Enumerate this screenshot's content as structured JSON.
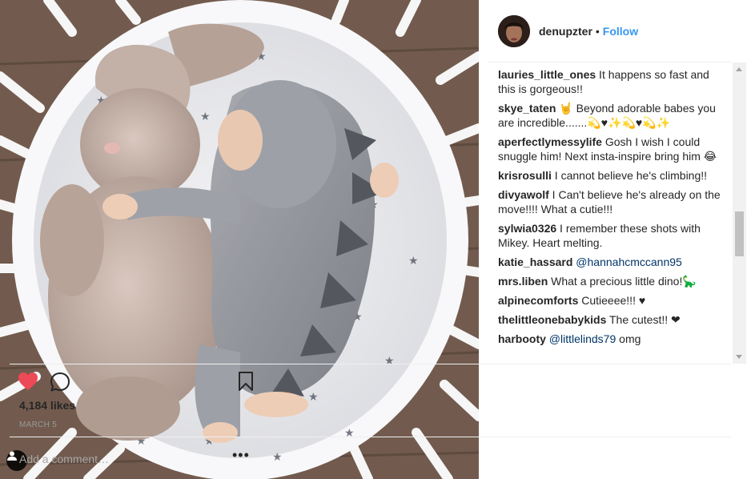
{
  "post": {
    "username": "denupzter",
    "separator": "•",
    "follow_label": "Follow",
    "likes": "4,184 likes",
    "date": "MARCH 5"
  },
  "comments": [
    {
      "user": "lauries_little_ones",
      "text": " It happens so fast and this is gorgeous!!"
    },
    {
      "user": "skye_taten",
      "text": " 🤘 Beyond adorable babes you are incredible.......💫♥✨💫♥💫✨"
    },
    {
      "user": "aperfectlymessylife",
      "text": " Gosh I wish I could snuggle him! Next insta-inspire bring him 😂"
    },
    {
      "user": "krisrosulli",
      "text": " I cannot believe he's climbing!!"
    },
    {
      "user": "divyawolf",
      "text": " I Can't believe he's already on the move!!!! What a cutie!!!"
    },
    {
      "user": "sylwia0326",
      "text": " I remember these shots with Mikey. Heart melting."
    },
    {
      "user": "katie_hassard",
      "text": " ",
      "mention": "@hannahcmccann95"
    },
    {
      "user": "mrs.liben",
      "text": " What a precious little dino!🦕"
    },
    {
      "user": "alpinecomforts",
      "text": " Cutieeee!!! ♥"
    },
    {
      "user": "thelittleonebabykids",
      "text": " The cutest!! ❤"
    },
    {
      "user": "harbooty",
      "text": " ",
      "mention": "@littlelinds79",
      "text_after": " omg"
    }
  ],
  "composer": {
    "placeholder": "Add a comment…",
    "more": "•••"
  },
  "icons": {
    "like": "heart-icon",
    "comment": "comment-bubble-icon",
    "save": "bookmark-icon",
    "tag": "person-tag-icon",
    "more": "more-dots-icon"
  },
  "colors": {
    "follow": "#3897f0",
    "heart": "#ed4956",
    "mention": "#003569"
  }
}
